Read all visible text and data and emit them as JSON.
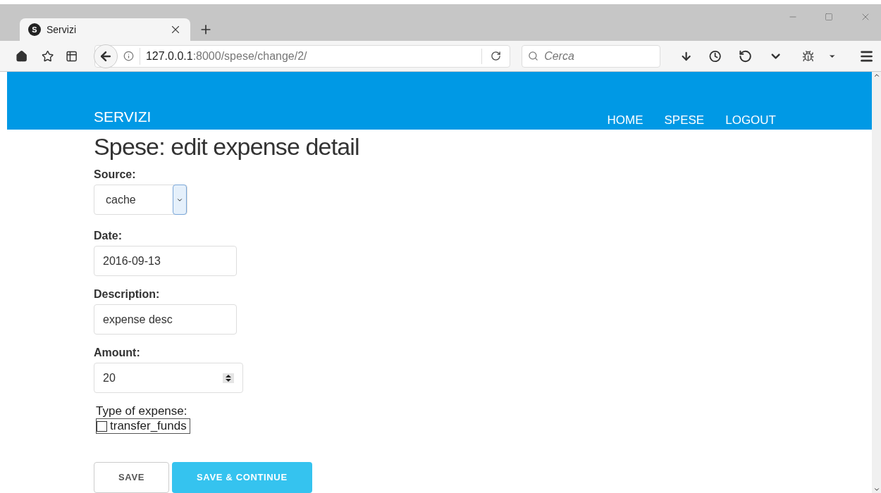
{
  "browser": {
    "tab_title": "Servizi",
    "tab_favicon": "S",
    "url_host": "127.0.0.1",
    "url_path": ":8000/spese/change/2/",
    "search_placeholder": "Cerca"
  },
  "navbar": {
    "brand": "SERVIZI",
    "links": [
      "HOME",
      "SPESE",
      "LOGOUT"
    ]
  },
  "page": {
    "title": "Spese: edit expense detail",
    "fields": [
      {
        "kind": "select",
        "label": "Source:",
        "value": "cache"
      },
      {
        "kind": "text",
        "label": "Date:",
        "value": "2016-09-13"
      },
      {
        "kind": "text",
        "label": "Description:",
        "value": "expense desc"
      },
      {
        "kind": "number",
        "label": "Amount:",
        "value": "20"
      },
      {
        "kind": "checkbox",
        "label": "Type of expense:",
        "option": "transfer_funds",
        "checked": false
      }
    ],
    "buttons": [
      {
        "label": "SAVE",
        "primary": false
      },
      {
        "label": "SAVE & CONTINUE",
        "primary": true
      }
    ]
  }
}
